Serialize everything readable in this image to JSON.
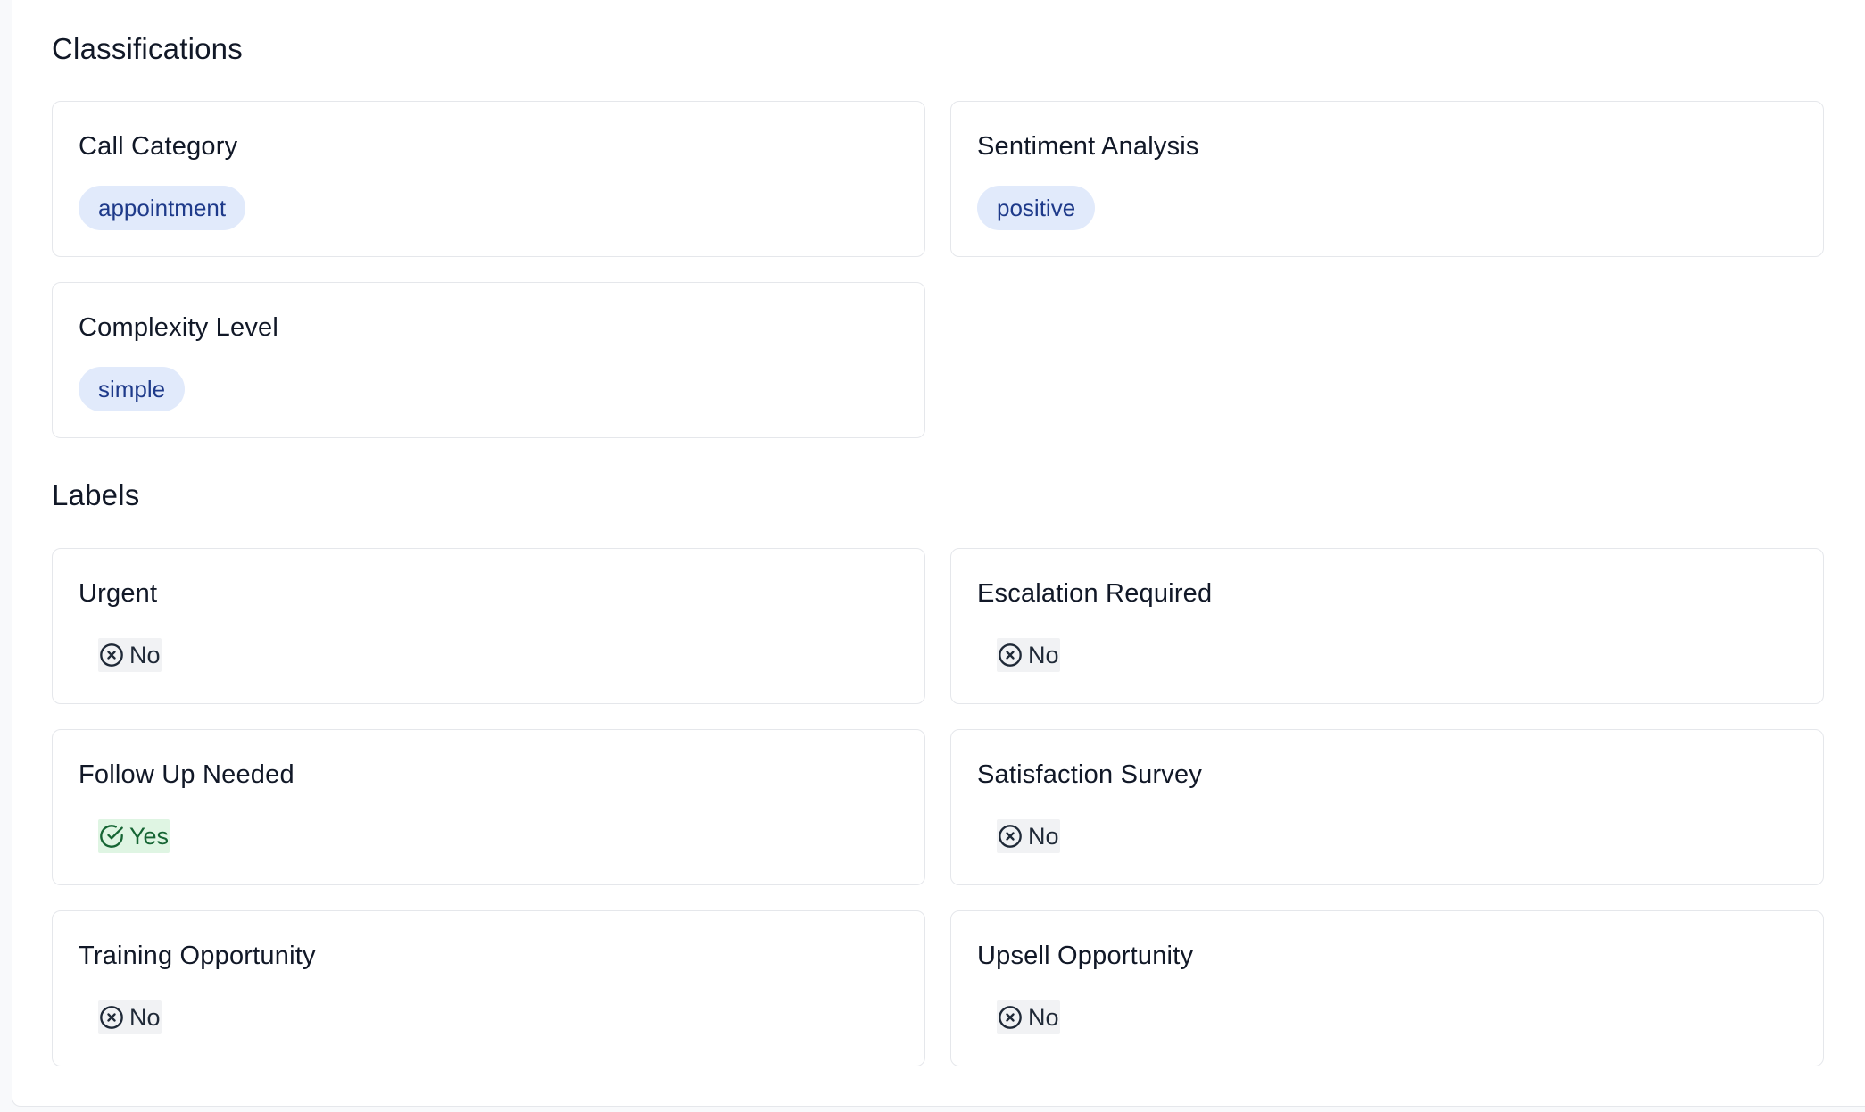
{
  "sections": {
    "classifications": {
      "title": "Classifications",
      "cards": [
        {
          "title": "Call Category",
          "value": "appointment"
        },
        {
          "title": "Sentiment Analysis",
          "value": "positive"
        },
        {
          "title": "Complexity Level",
          "value": "simple"
        }
      ]
    },
    "labels": {
      "title": "Labels",
      "cards": [
        {
          "title": "Urgent",
          "value": "No",
          "icon": "x-circle-icon"
        },
        {
          "title": "Escalation Required",
          "value": "No",
          "icon": "x-circle-icon"
        },
        {
          "title": "Follow Up Needed",
          "value": "Yes",
          "icon": "check-circle-icon"
        },
        {
          "title": "Satisfaction Survey",
          "value": "No",
          "icon": "x-circle-icon"
        },
        {
          "title": "Training Opportunity",
          "value": "No",
          "icon": "x-circle-icon"
        },
        {
          "title": "Upsell Opportunity",
          "value": "No",
          "icon": "x-circle-icon"
        }
      ]
    }
  },
  "colors": {
    "pill_bg": "#e1eafb",
    "pill_text": "#1e3a8a",
    "no_bg": "#f1f2f4",
    "yes_bg": "#dff5e3",
    "yes_text": "#166534"
  }
}
